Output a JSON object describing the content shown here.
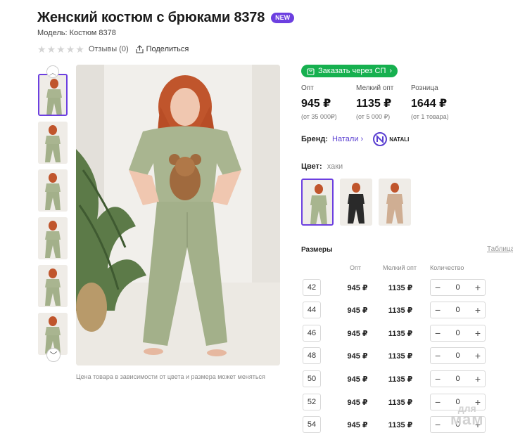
{
  "product": {
    "title": "Женский костюм с брюками 8378",
    "badge": "NEW",
    "model": "Модель: Костюм 8378",
    "reviews": "Отзывы (0)",
    "share": "Поделиться",
    "rating_stars": 0
  },
  "gallery": {
    "thumbnail_count": 6,
    "note": "Цена товара в зависимости от цвета и размера может меняться"
  },
  "purchase": {
    "sp_button": "Заказать через СП",
    "prices": [
      {
        "label": "Опт",
        "value": "945 ₽",
        "sub": "(от 35 000₽)"
      },
      {
        "label": "Мелкий опт",
        "value": "1135 ₽",
        "sub": "(от 5 000 ₽)"
      },
      {
        "label": "Розница",
        "value": "1644 ₽",
        "sub": "(от 1 товара)"
      }
    ]
  },
  "brand": {
    "label": "Бренд:",
    "name": "Натали",
    "logo_text": "NATALI"
  },
  "color": {
    "label": "Цвет:",
    "value": "хаки",
    "swatches": [
      "#a8b58f",
      "#2a2a2a",
      "#cfae93"
    ]
  },
  "sizes": {
    "title": "Размеры",
    "table_link": "Таблица",
    "headers": [
      "Опт",
      "Мелкий опт",
      "Количество"
    ],
    "rows": [
      {
        "size": "42",
        "opt": "945 ₽",
        "small_opt": "1135 ₽",
        "qty": "0"
      },
      {
        "size": "44",
        "opt": "945 ₽",
        "small_opt": "1135 ₽",
        "qty": "0"
      },
      {
        "size": "46",
        "opt": "945 ₽",
        "small_opt": "1135 ₽",
        "qty": "0"
      },
      {
        "size": "48",
        "opt": "945 ₽",
        "small_opt": "1135 ₽",
        "qty": "0"
      },
      {
        "size": "50",
        "opt": "945 ₽",
        "small_opt": "1135 ₽",
        "qty": "0"
      },
      {
        "size": "52",
        "opt": "945 ₽",
        "small_opt": "1135 ₽",
        "qty": "0"
      },
      {
        "size": "54",
        "opt": "945 ₽",
        "small_opt": "1135 ₽",
        "qty": "0"
      }
    ]
  },
  "watermark": {
    "line1": "для",
    "line2": "мам"
  },
  "colors": {
    "accent": "#6c3fe0",
    "green": "#16b04f",
    "khaki": "#a8b58f"
  }
}
